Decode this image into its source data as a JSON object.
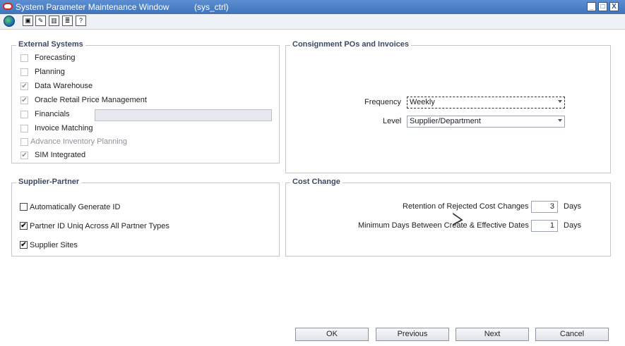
{
  "window": {
    "title": "System Parameter Maintenance Window",
    "module": "(sys_ctrl)",
    "controls": {
      "minimize": "_",
      "maximize": "□",
      "close": "X"
    }
  },
  "toolbar": {
    "icons": [
      "globe-icon",
      "print-icon",
      "edit-icon",
      "book-icon",
      "notes-icon",
      "help-icon"
    ],
    "help_glyph": "?"
  },
  "external_systems": {
    "title": "External Systems",
    "items": [
      {
        "label": "Forecasting",
        "checked": false,
        "enabled": false
      },
      {
        "label": "Planning",
        "checked": false,
        "enabled": false
      },
      {
        "label": "Data Warehouse",
        "checked": true,
        "enabled": false
      },
      {
        "label": "Oracle Retail Price Management",
        "checked": true,
        "enabled": false
      },
      {
        "label": "Financials",
        "checked": false,
        "enabled": false
      },
      {
        "label": "Invoice Matching",
        "checked": false,
        "enabled": false
      },
      {
        "label": "Advance Inventory Planning",
        "checked": false,
        "enabled": false
      },
      {
        "label": "SIM Integrated",
        "checked": true,
        "enabled": false
      }
    ],
    "financials_field": ""
  },
  "consignment": {
    "title": "Consignment POs and Invoices",
    "frequency_label": "Frequency",
    "frequency_value": "Weekly",
    "level_label": "Level",
    "level_value": "Supplier/Department"
  },
  "supplier_partner": {
    "title": "Supplier-Partner",
    "items": [
      {
        "label": "Automatically Generate ID",
        "checked": false
      },
      {
        "label": "Partner ID Uniq Across All Partner Types",
        "checked": true
      },
      {
        "label": "Supplier Sites",
        "checked": true
      }
    ]
  },
  "cost_change": {
    "title": "Cost Change",
    "retention_label": "Retention of Rejected Cost Changes",
    "retention_value": "3",
    "retention_unit": "Days",
    "min_days_label": "Minimum Days Between Create & Effective Dates",
    "min_days_value": "1",
    "min_days_unit": "Days"
  },
  "buttons": {
    "ok": "OK",
    "previous": "Previous",
    "next": "Next",
    "cancel": "Cancel"
  },
  "colors": {
    "titlebar": "#3e74bd",
    "group_title": "#3b4a63"
  }
}
